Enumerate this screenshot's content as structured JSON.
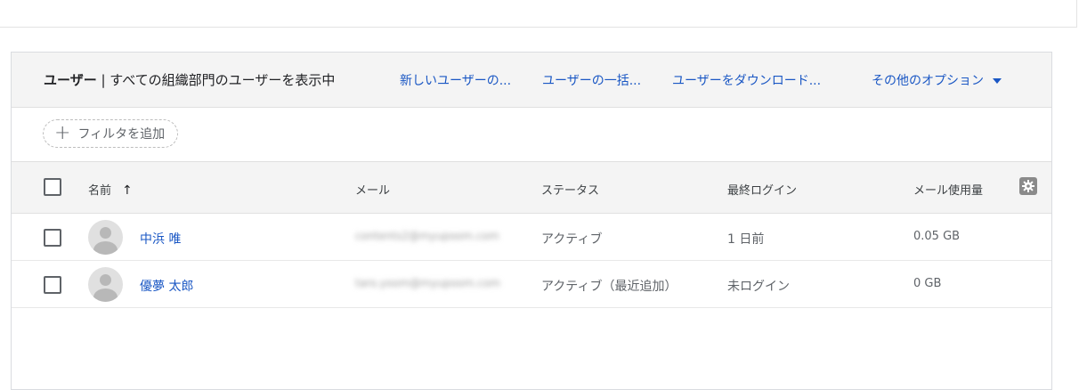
{
  "header": {
    "title_bold": "ユーザー",
    "title_rest": " | すべての組織部門のユーザーを表示中",
    "actions": [
      {
        "label": "新しいユーザーの..."
      },
      {
        "label": "ユーザーの一括..."
      },
      {
        "label": "ユーザーをダウンロード..."
      },
      {
        "label": "その他のオプション"
      }
    ]
  },
  "filter": {
    "label": "フィルタを追加"
  },
  "table": {
    "columns": {
      "name": "名前",
      "email": "メール",
      "status": "ステータス",
      "last_login": "最終ログイン",
      "mail_usage": "メール使用量"
    },
    "rows": [
      {
        "name": "中浜 唯",
        "email": "contents2@myupoom.com",
        "status": "アクティブ",
        "last_login": "1 日前",
        "mail_usage": "0.05 GB"
      },
      {
        "name": "優夢 太郎",
        "email": "taro.yoom@myupoom.com",
        "status": "アクティブ（最近追加）",
        "last_login": "未ログイン",
        "mail_usage": "0 GB"
      }
    ]
  }
}
